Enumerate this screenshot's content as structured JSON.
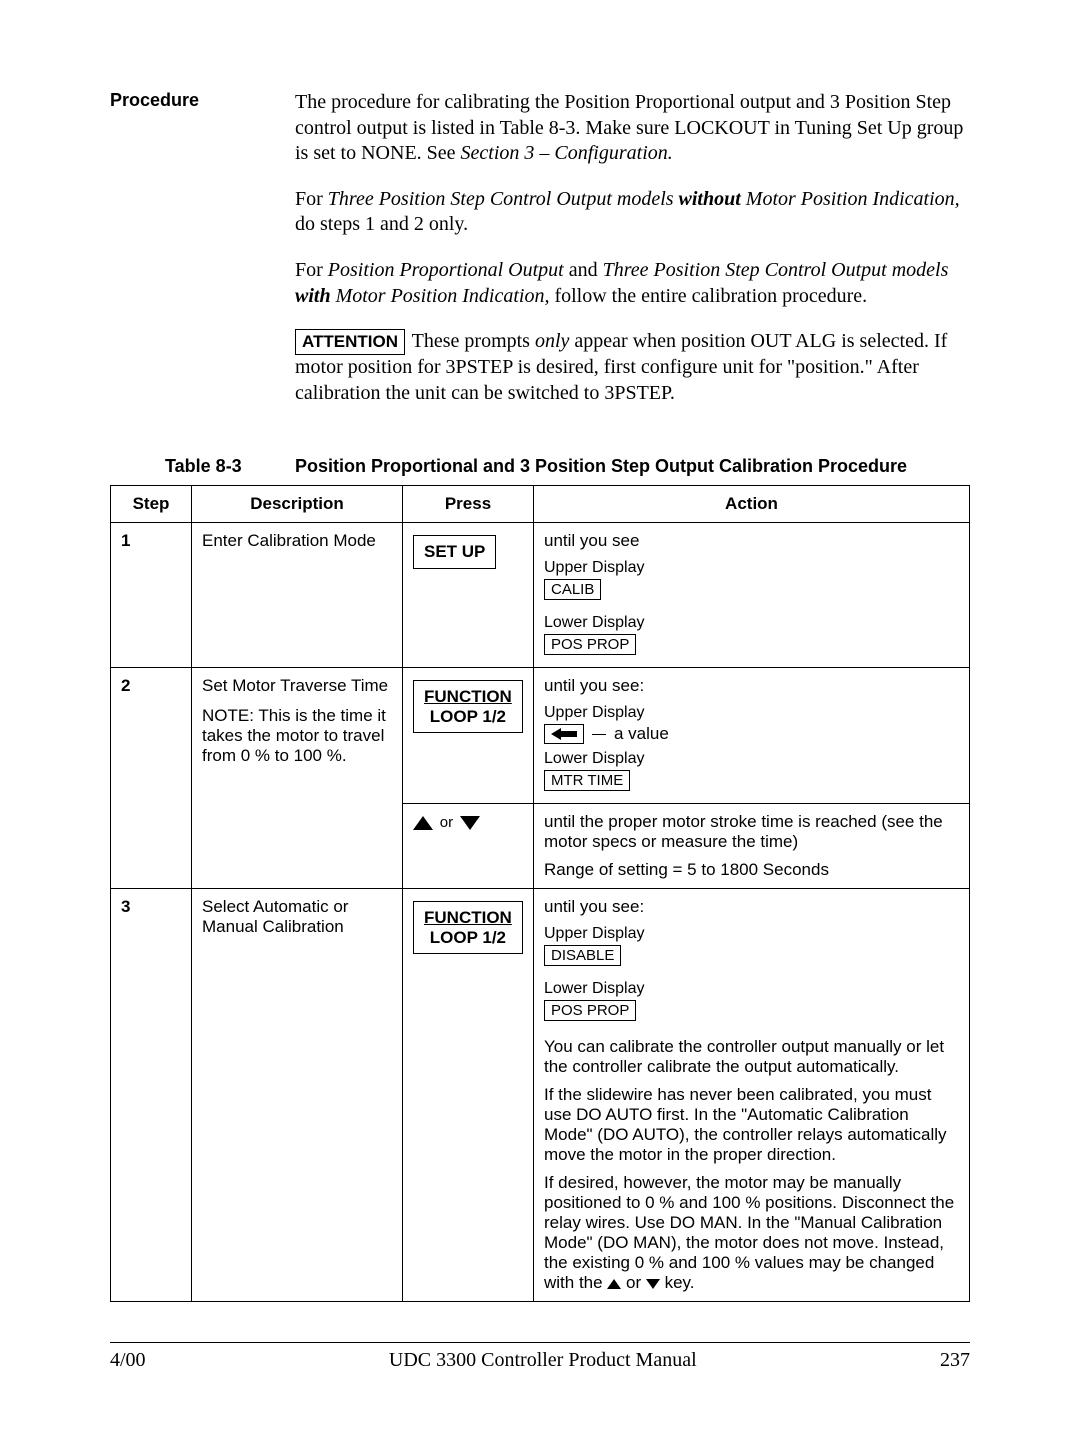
{
  "side_label": "Procedure",
  "intro": {
    "p1a": "The procedure for calibrating the Position Proportional output and 3 Position Step control output is listed in Table 8-3. Make sure LOCKOUT in Tuning Set Up group is set to NONE. See ",
    "p1b": "Section 3 – Configuration.",
    "p2a": "For ",
    "p2b": "Three Position Step Control Output models ",
    "p2c": "without",
    "p2d": " Motor Position Indication,",
    "p2e": " do steps 1 and 2 only.",
    "p3a": "For ",
    "p3b": "Position Proportional Output",
    "p3c": " and ",
    "p3d": "Three Position Step Control Output models ",
    "p3e": "with",
    "p3f": " Motor Position Indication,",
    "p3g": " follow the entire calibration procedure.",
    "attention_label": "ATTENTION",
    "p4a": " These prompts ",
    "p4b": "only",
    "p4c": " appear when position OUT ALG is selected. If motor position for 3PSTEP is desired, first configure unit for \"position.\" After calibration the unit can be switched to 3PSTEP."
  },
  "table": {
    "caption_left": "Table 8-3",
    "caption_right": "Position Proportional and 3 Position Step Output Calibration Procedure",
    "headers": {
      "step": "Step",
      "desc": "Description",
      "press": "Press",
      "action": "Action"
    },
    "rows": {
      "r1": {
        "step": "1",
        "desc": "Enter Calibration Mode",
        "press": "SET UP",
        "action": {
          "until": "until you see",
          "upper_label": "Upper Display",
          "upper_value": "CALIB",
          "lower_label": "Lower Display",
          "lower_value": "POS PROP"
        }
      },
      "r2a": {
        "step": "2",
        "desc1": "Set Motor Traverse Time",
        "desc2": "NOTE: This is the time it takes the motor to travel from 0 % to 100 %.",
        "press_line1": "FUNCTION",
        "press_line2": "LOOP 1/2",
        "action": {
          "until": "until you see:",
          "upper_label": "Upper Display",
          "value_hint": "a value",
          "lower_label": "Lower Display",
          "lower_value": "MTR TIME"
        }
      },
      "r2b": {
        "or": "or",
        "action1": "until the proper motor stroke time is reached (see the motor specs or measure the time)",
        "action2": "Range of setting = 5 to 1800 Seconds"
      },
      "r3": {
        "step": "3",
        "desc": "Select Automatic or Manual Calibration",
        "press_line1": "FUNCTION",
        "press_line2": "LOOP 1/2",
        "action": {
          "until": "until you see:",
          "upper_label": "Upper Display",
          "upper_value": "DISABLE",
          "lower_label": "Lower Display",
          "lower_value": "POS PROP",
          "p1": "You can calibrate the controller output manually or let the controller calibrate the output automatically.",
          "p2": "If the slidewire has never been calibrated, you must use DO AUTO first. In the \"Automatic Calibration Mode\" (DO AUTO), the controller relays automatically move the motor in the proper direction.",
          "p3a": "If desired, however, the motor may be manually positioned to 0 % and 100 % positions. Disconnect the relay wires. Use DO MAN. In the \"Manual Calibration Mode\" (DO MAN), the motor does not move. Instead, the existing 0 % and 100 % values may be changed with the ",
          "p3b": " or ",
          "p3c": " key."
        }
      }
    }
  },
  "footer": {
    "left": "4/00",
    "center": "UDC 3300 Controller Product Manual",
    "right": "237"
  }
}
